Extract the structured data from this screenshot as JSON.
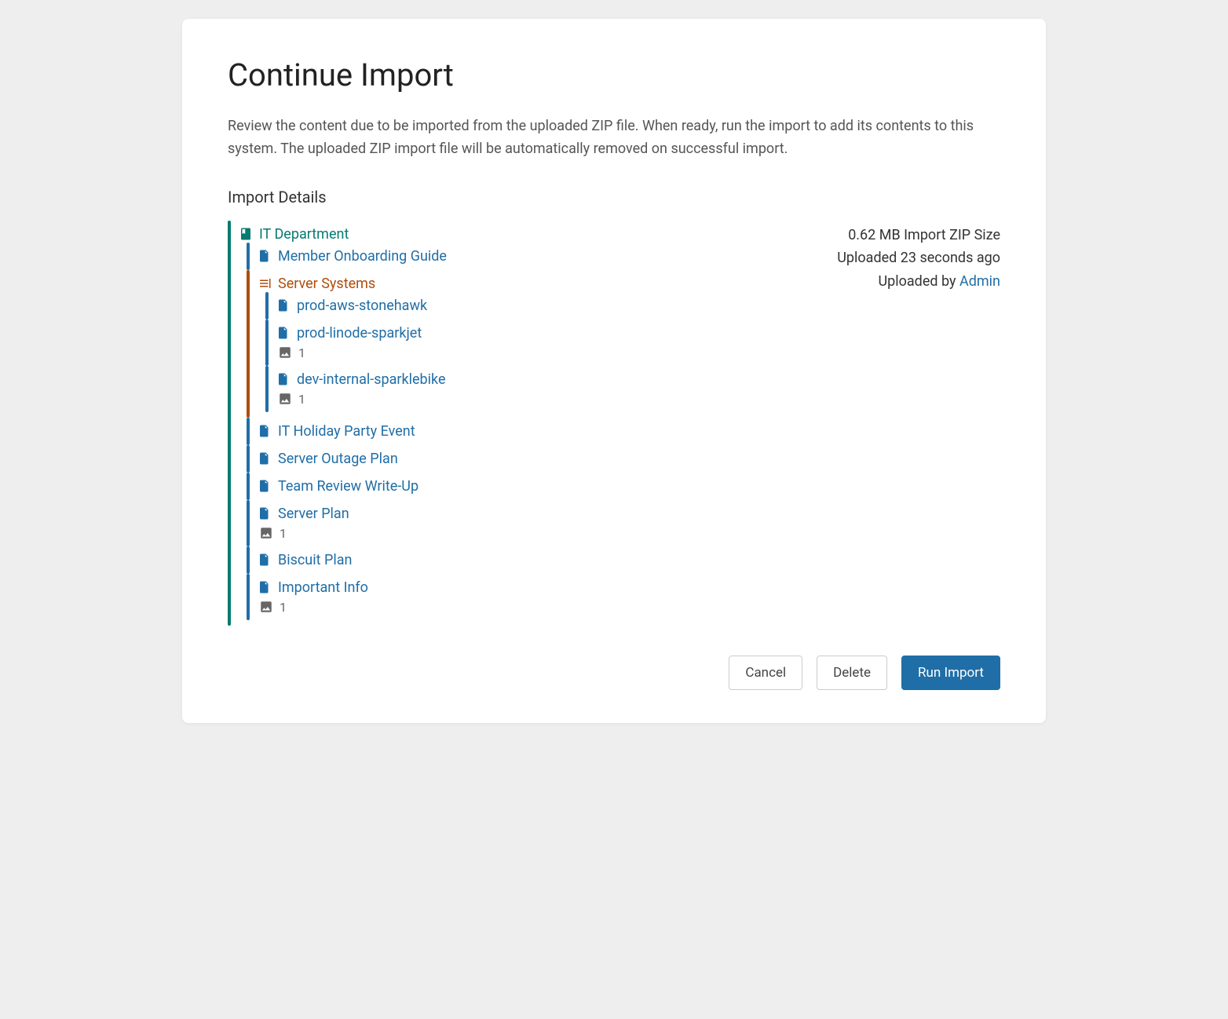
{
  "title": "Continue Import",
  "description": "Review the content due to be imported from the uploaded ZIP file. When ready, run the import to add its contents to this system. The uploaded ZIP import file will be automatically removed on successful import.",
  "section_heading": "Import Details",
  "meta": {
    "size": "0.62 MB Import ZIP Size",
    "uploaded_time": "Uploaded 23 seconds ago",
    "uploaded_by_prefix": "Uploaded by ",
    "uploaded_by_user": "Admin"
  },
  "tree": {
    "book": {
      "label": "IT Department",
      "children": [
        {
          "type": "page",
          "label": "Member Onboarding Guide",
          "attachments": 0
        },
        {
          "type": "chapter",
          "label": "Server Systems",
          "children": [
            {
              "type": "page",
              "label": "prod-aws-stonehawk",
              "attachments": 0
            },
            {
              "type": "page",
              "label": "prod-linode-sparkjet",
              "attachments": 1
            },
            {
              "type": "page",
              "label": "dev-internal-sparklebike",
              "attachments": 1
            }
          ]
        },
        {
          "type": "page",
          "label": "IT Holiday Party Event",
          "attachments": 0
        },
        {
          "type": "page",
          "label": "Server Outage Plan",
          "attachments": 0
        },
        {
          "type": "page",
          "label": "Team Review Write-Up",
          "attachments": 0
        },
        {
          "type": "page",
          "label": "Server Plan",
          "attachments": 1
        },
        {
          "type": "page",
          "label": "Biscuit Plan",
          "attachments": 0
        },
        {
          "type": "page",
          "label": "Important Info",
          "attachments": 1
        }
      ]
    }
  },
  "buttons": {
    "cancel": "Cancel",
    "delete": "Delete",
    "run": "Run Import"
  }
}
